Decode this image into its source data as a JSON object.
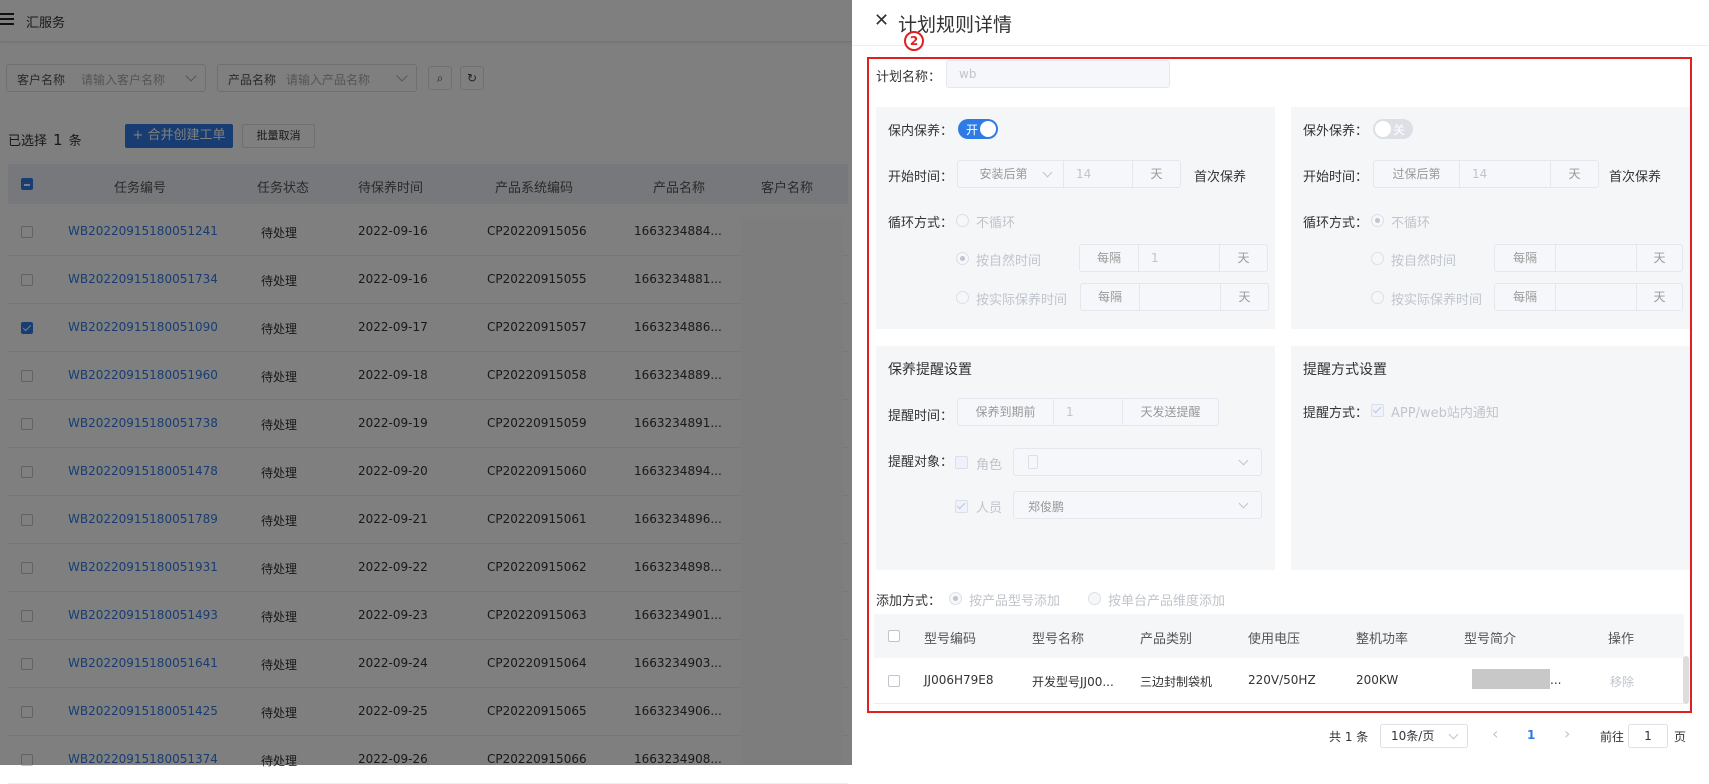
{
  "app": {
    "title": "汇服务"
  },
  "filters": {
    "customer_label": "客户名称",
    "customer_placeholder": "请输入客户名称",
    "product_label": "产品名称",
    "product_placeholder": "请输入产品名称",
    "search_icon": "⌕",
    "refresh_icon": "↻"
  },
  "toolbar": {
    "selected_prefix": "已选择",
    "selected_count": "1",
    "selected_suffix": "条",
    "merge_button": "+ 合并创建工单",
    "batch_cancel": "批量取消"
  },
  "table": {
    "columns": [
      "任务编号",
      "任务状态",
      "待保养时间",
      "产品系统编码",
      "产品名称",
      "客户名称"
    ],
    "rows": [
      {
        "id": "WB20220915180051241",
        "status": "待处理",
        "date": "2022-09-16",
        "code": "CP20220915056",
        "name": "1663234884...",
        "checked": false
      },
      {
        "id": "WB20220915180051734",
        "status": "待处理",
        "date": "2022-09-16",
        "code": "CP20220915055",
        "name": "1663234881...",
        "checked": false
      },
      {
        "id": "WB20220915180051090",
        "status": "待处理",
        "date": "2022-09-17",
        "code": "CP20220915057",
        "name": "1663234886...",
        "checked": true
      },
      {
        "id": "WB20220915180051960",
        "status": "待处理",
        "date": "2022-09-18",
        "code": "CP20220915058",
        "name": "1663234889...",
        "checked": false
      },
      {
        "id": "WB20220915180051738",
        "status": "待处理",
        "date": "2022-09-19",
        "code": "CP20220915059",
        "name": "1663234891...",
        "checked": false
      },
      {
        "id": "WB20220915180051478",
        "status": "待处理",
        "date": "2022-09-20",
        "code": "CP20220915060",
        "name": "1663234894...",
        "checked": false
      },
      {
        "id": "WB20220915180051789",
        "status": "待处理",
        "date": "2022-09-21",
        "code": "CP20220915061",
        "name": "1663234896...",
        "checked": false
      },
      {
        "id": "WB20220915180051931",
        "status": "待处理",
        "date": "2022-09-22",
        "code": "CP20220915062",
        "name": "1663234898...",
        "checked": false
      },
      {
        "id": "WB20220915180051493",
        "status": "待处理",
        "date": "2022-09-23",
        "code": "CP20220915063",
        "name": "1663234901...",
        "checked": false
      },
      {
        "id": "WB20220915180051641",
        "status": "待处理",
        "date": "2022-09-24",
        "code": "CP20220915064",
        "name": "1663234903...",
        "checked": false
      },
      {
        "id": "WB20220915180051425",
        "status": "待处理",
        "date": "2022-09-25",
        "code": "CP20220915065",
        "name": "1663234906...",
        "checked": false
      },
      {
        "id": "WB20220915180051374",
        "status": "待处理",
        "date": "2022-09-26",
        "code": "CP20220915066",
        "name": "1663234908...",
        "checked": false
      }
    ]
  },
  "drawer": {
    "close_icon": "✕",
    "title": "计划规则详情",
    "marker": "2",
    "plan_name_label": "计划名称：",
    "plan_name_value": "wb",
    "inner": {
      "switch_label": "保内保养：",
      "switch_text": "开",
      "start_label": "开始时间：",
      "start_select": "安装后第",
      "start_days": "14",
      "day_unit": "天",
      "first_text": "首次保养",
      "cycle_label": "循环方式：",
      "opt_none": "不循环",
      "opt_natural": "按自然时间",
      "opt_actual": "按实际保养时间",
      "every": "每隔",
      "natural_value": "1",
      "actual_value": ""
    },
    "outer": {
      "switch_label": "保外保养：",
      "switch_text": "关",
      "start_label": "开始时间：",
      "start_select": "过保后第",
      "start_days": "14",
      "day_unit": "天",
      "first_text": "首次保养",
      "cycle_label": "循环方式：",
      "opt_none": "不循环",
      "opt_natural": "按自然时间",
      "opt_actual": "按实际保养时间",
      "every": "每隔"
    },
    "remind": {
      "title": "保养提醒设置",
      "time_label": "提醒时间：",
      "time_prefix": "保养到期前",
      "time_value": "1",
      "time_suffix": "天发送提醒",
      "target_label": "提醒对象：",
      "role": "角色",
      "person": "人员",
      "person_value": "郑俊鹏"
    },
    "method": {
      "title": "提醒方式设置",
      "label": "提醒方式：",
      "option": "APP/web站内通知"
    },
    "add": {
      "label": "添加方式：",
      "opt_model": "按产品型号添加",
      "opt_single": "按单台产品维度添加"
    },
    "models": {
      "columns": [
        "型号编码",
        "型号名称",
        "产品类别",
        "使用电压",
        "整机功率",
        "型号简介",
        "操作"
      ],
      "rows": [
        {
          "code": "JJ006H79E8",
          "name": "开发型号JJ00...",
          "category": "三边封制袋机",
          "voltage": "220V/50HZ",
          "power": "200KW",
          "intro": "...",
          "action": "移除"
        }
      ]
    },
    "pagination": {
      "total": "共 1 条",
      "page_size": "10条/页",
      "prev": "‹",
      "current": "1",
      "next": "›",
      "goto_prefix": "前往",
      "goto_value": "1",
      "goto_suffix": "页"
    }
  },
  "colors": {
    "primary": "#2f7be6",
    "annotation": "#e02020",
    "overlay": "rgba(0,0,0,0.5)"
  }
}
